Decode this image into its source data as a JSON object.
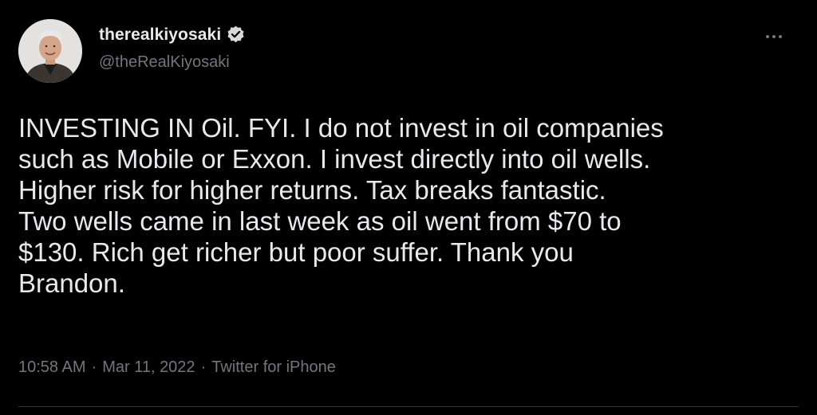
{
  "author": {
    "display_name": "therealkiyosaki",
    "handle": "@theRealKiyosaki",
    "verified": true,
    "avatar_icon": "profile-photo"
  },
  "menu": {
    "more_icon": "ellipsis-icon"
  },
  "tweet": {
    "text": "INVESTING IN Oil. FYI. I do not invest in oil companies\nsuch as Mobile or Exxon. I invest directly into oil wells.\nHigher risk for higher returns. Tax breaks fantastic.\nTwo wells came in last week as oil went from $70 to\n$130. Rich get richer but poor suffer. Thank you\nBrandon."
  },
  "meta": {
    "time": "10:58 AM",
    "separator_1": "·",
    "date": "Mar 11, 2022",
    "separator_2": "·",
    "source": "Twitter for iPhone"
  },
  "colors": {
    "background": "#000000",
    "primary_text": "#e7e9ea",
    "secondary_text": "#71767b",
    "verified_badge": "#d9d9d9"
  }
}
